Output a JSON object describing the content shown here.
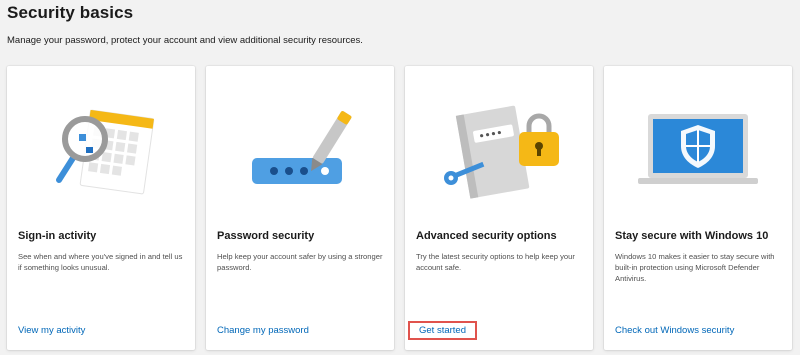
{
  "header": {
    "title": "Security basics",
    "subtitle": "Manage your password, protect your account and view additional security resources."
  },
  "cards": [
    {
      "title": "Sign-in activity",
      "description": "See when and where you've signed in and tell us if something looks unusual.",
      "link": "View my activity",
      "illustration": "magnifier-calendar-icon"
    },
    {
      "title": "Password security",
      "description": "Help keep your account safer by using a stronger password.",
      "link": "Change my password",
      "illustration": "password-pen-icon"
    },
    {
      "title": "Advanced security options",
      "description": "Try the latest security options to help keep your account safe.",
      "link": "Get started",
      "illustration": "key-lock-book-icon"
    },
    {
      "title": "Stay secure with Windows 10",
      "description": "Windows 10 makes it easier to stay secure with built-in protection using Microsoft Defender Antivirus.",
      "link": "Check out Windows security",
      "illustration": "laptop-shield-icon"
    }
  ],
  "colors": {
    "link": "#0067b8",
    "highlight_border": "#e0534d",
    "accent_blue": "#3d8fd9",
    "accent_yellow": "#f5b816",
    "page_background": "#f2f2f2"
  }
}
